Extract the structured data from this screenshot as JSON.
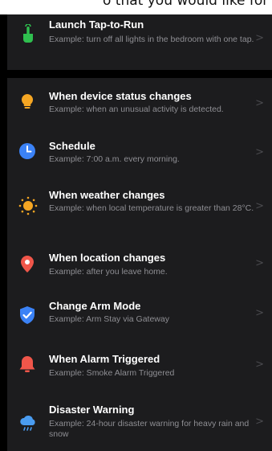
{
  "header_cropped_text": "o that you would like for yo",
  "tap_to_run": {
    "title": "Launch Tap-to-Run",
    "description": "Example: turn off all lights in the bedroom with one tap.",
    "icon": "tap-hand-icon",
    "color": "#2fbf4f"
  },
  "conditions": [
    {
      "title": "When device status changes",
      "description": "Example: when an unusual activity is detected.",
      "icon": "lightbulb-icon",
      "color": "#f5a623"
    },
    {
      "title": "Schedule",
      "description": "Example: 7:00 a.m. every morning.",
      "icon": "clock-icon",
      "color": "#3b82f6"
    },
    {
      "title": "When weather changes",
      "description": "Example: when local temperature is greater than 28°C.",
      "icon": "sun-icon",
      "color": "#f5a623"
    },
    {
      "title": "When location changes",
      "description": "Example: after you leave home.",
      "icon": "location-pin-icon",
      "color": "#f0564a"
    },
    {
      "title": "Change Arm Mode",
      "description": "Example: Arm Stay via Gateway",
      "icon": "shield-check-icon",
      "color": "#3b82f6"
    },
    {
      "title": "When Alarm Triggered",
      "description": "Example: Smoke Alarm Triggered",
      "icon": "alarm-bell-icon",
      "color": "#f0564a"
    },
    {
      "title": "Disaster Warning",
      "description": "Example: 24-hour disaster warning for heavy rain and snow",
      "icon": "rain-cloud-icon",
      "color": "#4a9cf0"
    }
  ],
  "chevron": ">"
}
